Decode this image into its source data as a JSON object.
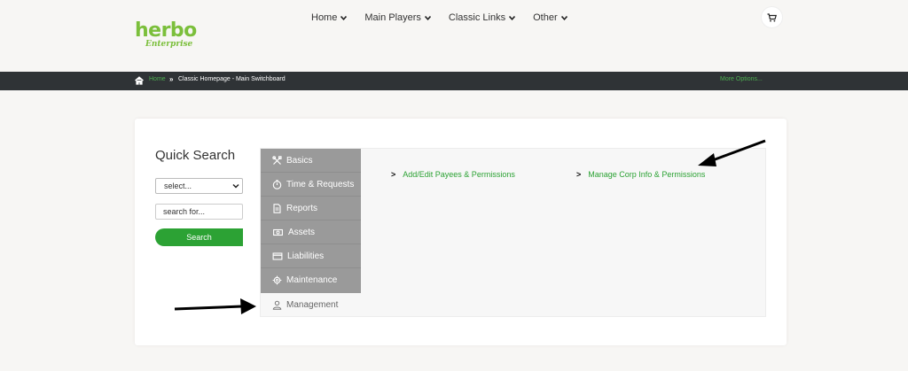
{
  "header": {
    "logo_main": "herbo",
    "logo_sub": "Enterprise",
    "nav": [
      {
        "label": "Home"
      },
      {
        "label": "Main Players"
      },
      {
        "label": "Classic Links"
      },
      {
        "label": "Other"
      }
    ],
    "cart_icon": "cart-icon"
  },
  "breadcrumb": {
    "home_label": "Home",
    "current": "Classic Homepage - Main Switchboard",
    "more_options": "More Options..."
  },
  "quick_search": {
    "title": "Quick Search",
    "select_value": "select...",
    "input_placeholder": "search for...",
    "button_label": "Search"
  },
  "switchboard": {
    "menu": [
      {
        "label": "Basics",
        "icon": "tools-icon"
      },
      {
        "label": "Time & Requests",
        "icon": "stopwatch-icon"
      },
      {
        "label": "Reports",
        "icon": "document-icon"
      },
      {
        "label": "Assets",
        "icon": "money-icon"
      },
      {
        "label": "Liabilities",
        "icon": "credit-card-icon"
      },
      {
        "label": "Maintenance",
        "icon": "gear-icon"
      },
      {
        "label": "Management",
        "icon": "user-icon"
      }
    ],
    "active_item": "Management",
    "links": [
      {
        "label": "Add/Edit Payees & Permissions"
      },
      {
        "label": "Manage Corp Info & Permissions"
      }
    ]
  },
  "colors": {
    "accent_green": "#2ca234",
    "logo_green": "#7bbf3b",
    "bar_dark": "#2f3336",
    "menu_gray": "#9a9a9a"
  }
}
